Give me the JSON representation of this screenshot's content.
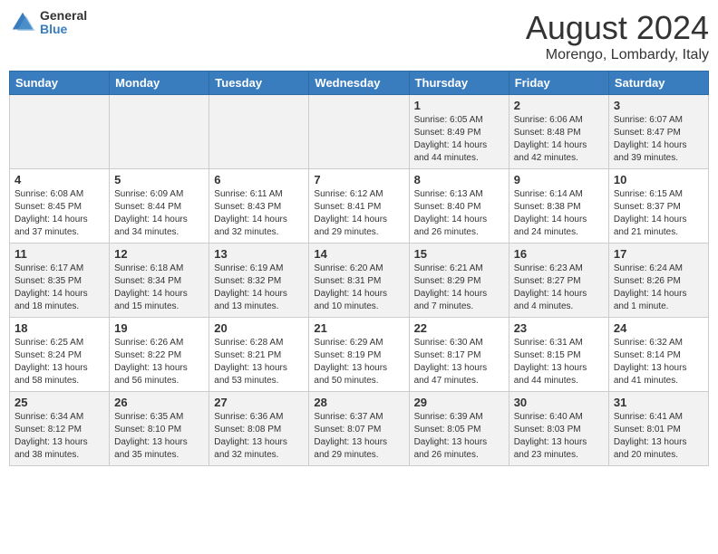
{
  "logo": {
    "general": "General",
    "blue": "Blue"
  },
  "title": {
    "month_year": "August 2024",
    "location": "Morengo, Lombardy, Italy"
  },
  "headers": [
    "Sunday",
    "Monday",
    "Tuesday",
    "Wednesday",
    "Thursday",
    "Friday",
    "Saturday"
  ],
  "weeks": [
    [
      {
        "day": "",
        "info": ""
      },
      {
        "day": "",
        "info": ""
      },
      {
        "day": "",
        "info": ""
      },
      {
        "day": "",
        "info": ""
      },
      {
        "day": "1",
        "info": "Sunrise: 6:05 AM\nSunset: 8:49 PM\nDaylight: 14 hours and 44 minutes."
      },
      {
        "day": "2",
        "info": "Sunrise: 6:06 AM\nSunset: 8:48 PM\nDaylight: 14 hours and 42 minutes."
      },
      {
        "day": "3",
        "info": "Sunrise: 6:07 AM\nSunset: 8:47 PM\nDaylight: 14 hours and 39 minutes."
      }
    ],
    [
      {
        "day": "4",
        "info": "Sunrise: 6:08 AM\nSunset: 8:45 PM\nDaylight: 14 hours and 37 minutes."
      },
      {
        "day": "5",
        "info": "Sunrise: 6:09 AM\nSunset: 8:44 PM\nDaylight: 14 hours and 34 minutes."
      },
      {
        "day": "6",
        "info": "Sunrise: 6:11 AM\nSunset: 8:43 PM\nDaylight: 14 hours and 32 minutes."
      },
      {
        "day": "7",
        "info": "Sunrise: 6:12 AM\nSunset: 8:41 PM\nDaylight: 14 hours and 29 minutes."
      },
      {
        "day": "8",
        "info": "Sunrise: 6:13 AM\nSunset: 8:40 PM\nDaylight: 14 hours and 26 minutes."
      },
      {
        "day": "9",
        "info": "Sunrise: 6:14 AM\nSunset: 8:38 PM\nDaylight: 14 hours and 24 minutes."
      },
      {
        "day": "10",
        "info": "Sunrise: 6:15 AM\nSunset: 8:37 PM\nDaylight: 14 hours and 21 minutes."
      }
    ],
    [
      {
        "day": "11",
        "info": "Sunrise: 6:17 AM\nSunset: 8:35 PM\nDaylight: 14 hours and 18 minutes."
      },
      {
        "day": "12",
        "info": "Sunrise: 6:18 AM\nSunset: 8:34 PM\nDaylight: 14 hours and 15 minutes."
      },
      {
        "day": "13",
        "info": "Sunrise: 6:19 AM\nSunset: 8:32 PM\nDaylight: 14 hours and 13 minutes."
      },
      {
        "day": "14",
        "info": "Sunrise: 6:20 AM\nSunset: 8:31 PM\nDaylight: 14 hours and 10 minutes."
      },
      {
        "day": "15",
        "info": "Sunrise: 6:21 AM\nSunset: 8:29 PM\nDaylight: 14 hours and 7 minutes."
      },
      {
        "day": "16",
        "info": "Sunrise: 6:23 AM\nSunset: 8:27 PM\nDaylight: 14 hours and 4 minutes."
      },
      {
        "day": "17",
        "info": "Sunrise: 6:24 AM\nSunset: 8:26 PM\nDaylight: 14 hours and 1 minute."
      }
    ],
    [
      {
        "day": "18",
        "info": "Sunrise: 6:25 AM\nSunset: 8:24 PM\nDaylight: 13 hours and 58 minutes."
      },
      {
        "day": "19",
        "info": "Sunrise: 6:26 AM\nSunset: 8:22 PM\nDaylight: 13 hours and 56 minutes."
      },
      {
        "day": "20",
        "info": "Sunrise: 6:28 AM\nSunset: 8:21 PM\nDaylight: 13 hours and 53 minutes."
      },
      {
        "day": "21",
        "info": "Sunrise: 6:29 AM\nSunset: 8:19 PM\nDaylight: 13 hours and 50 minutes."
      },
      {
        "day": "22",
        "info": "Sunrise: 6:30 AM\nSunset: 8:17 PM\nDaylight: 13 hours and 47 minutes."
      },
      {
        "day": "23",
        "info": "Sunrise: 6:31 AM\nSunset: 8:15 PM\nDaylight: 13 hours and 44 minutes."
      },
      {
        "day": "24",
        "info": "Sunrise: 6:32 AM\nSunset: 8:14 PM\nDaylight: 13 hours and 41 minutes."
      }
    ],
    [
      {
        "day": "25",
        "info": "Sunrise: 6:34 AM\nSunset: 8:12 PM\nDaylight: 13 hours and 38 minutes."
      },
      {
        "day": "26",
        "info": "Sunrise: 6:35 AM\nSunset: 8:10 PM\nDaylight: 13 hours and 35 minutes."
      },
      {
        "day": "27",
        "info": "Sunrise: 6:36 AM\nSunset: 8:08 PM\nDaylight: 13 hours and 32 minutes."
      },
      {
        "day": "28",
        "info": "Sunrise: 6:37 AM\nSunset: 8:07 PM\nDaylight: 13 hours and 29 minutes."
      },
      {
        "day": "29",
        "info": "Sunrise: 6:39 AM\nSunset: 8:05 PM\nDaylight: 13 hours and 26 minutes."
      },
      {
        "day": "30",
        "info": "Sunrise: 6:40 AM\nSunset: 8:03 PM\nDaylight: 13 hours and 23 minutes."
      },
      {
        "day": "31",
        "info": "Sunrise: 6:41 AM\nSunset: 8:01 PM\nDaylight: 13 hours and 20 minutes."
      }
    ]
  ]
}
